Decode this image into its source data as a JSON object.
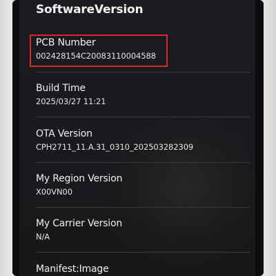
{
  "screen": {
    "title": "SoftwareVersion"
  },
  "items": [
    {
      "label": "PCB Number",
      "value": "002428154C20083110004588"
    },
    {
      "label": "Build Time",
      "value": "2025/03/27 11:21"
    },
    {
      "label": "OTA Version",
      "value": "CPH2711_11.A.31_0310_202503282309"
    },
    {
      "label": "My Region Version",
      "value": "X00VN00"
    },
    {
      "label": "My Carrier Version",
      "value": "N/A"
    },
    {
      "label": "Manifest:Image",
      "value": ""
    }
  ],
  "highlight": {
    "color": "#e0262c",
    "target": "PCB Number"
  }
}
